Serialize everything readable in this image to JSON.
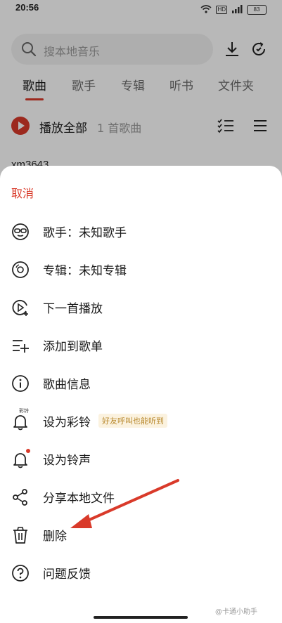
{
  "status_bar": {
    "time": "20:56",
    "battery": "83",
    "network_badge": "HD",
    "icons": [
      "wifi-icon",
      "hd-icon",
      "signal-icon",
      "battery-icon"
    ]
  },
  "search": {
    "placeholder": "搜本地音乐"
  },
  "tabs": [
    {
      "label": "歌曲",
      "active": true
    },
    {
      "label": "歌手",
      "active": false
    },
    {
      "label": "专辑",
      "active": false
    },
    {
      "label": "听书",
      "active": false
    },
    {
      "label": "文件夹",
      "active": false
    }
  ],
  "play_all": {
    "label": "播放全部",
    "count": "1 首歌曲"
  },
  "partial_song_title": "xm3643",
  "sheet": {
    "cancel": "取消",
    "items": [
      {
        "label": "歌手：未知歌手",
        "icon": "singer-icon"
      },
      {
        "label": "专辑：未知专辑",
        "icon": "album-icon"
      },
      {
        "label": "下一首播放",
        "icon": "play-next-icon"
      },
      {
        "label": "添加到歌单",
        "icon": "add-to-playlist-icon"
      },
      {
        "label": "歌曲信息",
        "icon": "info-icon"
      },
      {
        "label": "设为彩铃",
        "icon": "ringback-bell-icon",
        "badge": "好友呼叫也能听到",
        "icon_tag": "彩铃"
      },
      {
        "label": "设为铃声",
        "icon": "ringtone-bell-icon"
      },
      {
        "label": "分享本地文件",
        "icon": "share-icon"
      },
      {
        "label": "删除",
        "icon": "trash-icon"
      },
      {
        "label": "问题反馈",
        "icon": "help-icon"
      }
    ]
  },
  "watermark": "@卡通小助手",
  "colors": {
    "accent": "#d93a2a",
    "text": "#1a1a1a",
    "muted": "#9a9a9a"
  }
}
